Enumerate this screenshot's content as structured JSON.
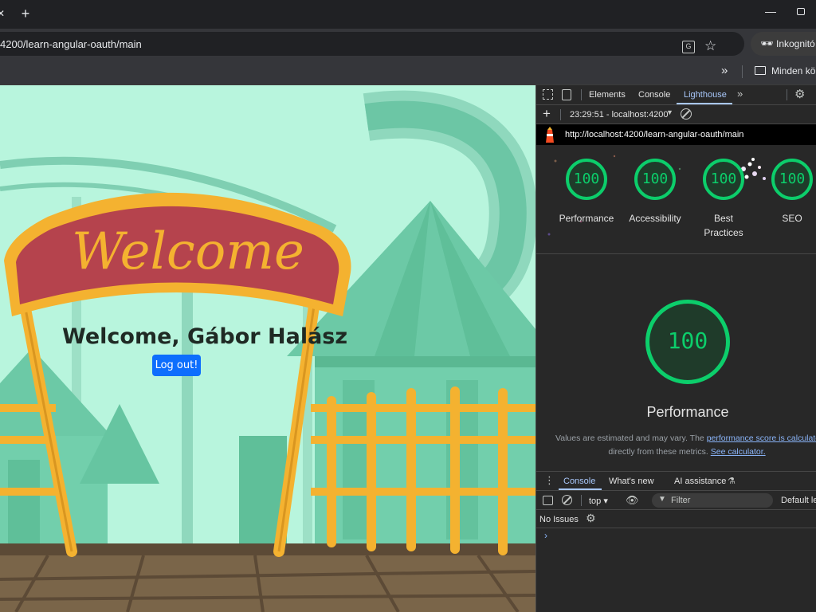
{
  "browser": {
    "url": "4200/learn-angular-oauth/main",
    "incognito_label": "Inkognitó",
    "bookmarks_folder": "Minden kön"
  },
  "page": {
    "welcome_text": "Welcome, Gábor Halász",
    "logout_label": "Log out!",
    "sign_text": "Welcome"
  },
  "devtools": {
    "tabs": [
      "Elements",
      "Console",
      "Lighthouse"
    ],
    "active_tab": "Lighthouse",
    "report_select": "23:29:51 - localhost:4200",
    "report_url": "http://localhost:4200/learn-angular-oauth/main",
    "scores": [
      {
        "label": "Performance",
        "value": "100"
      },
      {
        "label": "Accessibility",
        "value": "100"
      },
      {
        "label": "Best Practices",
        "value": "100"
      },
      {
        "label": "SEO",
        "value": "100"
      }
    ],
    "main_score": {
      "label": "Performance",
      "value": "100"
    },
    "note_prefix": "Values are estimated and may vary. The ",
    "note_link1": "performance score is calculate",
    "note_line2_prefix": "directly from these metrics. ",
    "note_link2": "See calculator.",
    "drawer_tabs": [
      "Console",
      "What's new",
      "AI assistance"
    ],
    "console_context": "top ▾",
    "filter_placeholder": "Filter",
    "default_levels": "Default le",
    "no_issues": "No Issues",
    "prompt": "›"
  },
  "colors": {
    "score_green": "#0cce6b",
    "accent_blue": "#a8c7fa",
    "logout_button": "#0d6efd"
  }
}
